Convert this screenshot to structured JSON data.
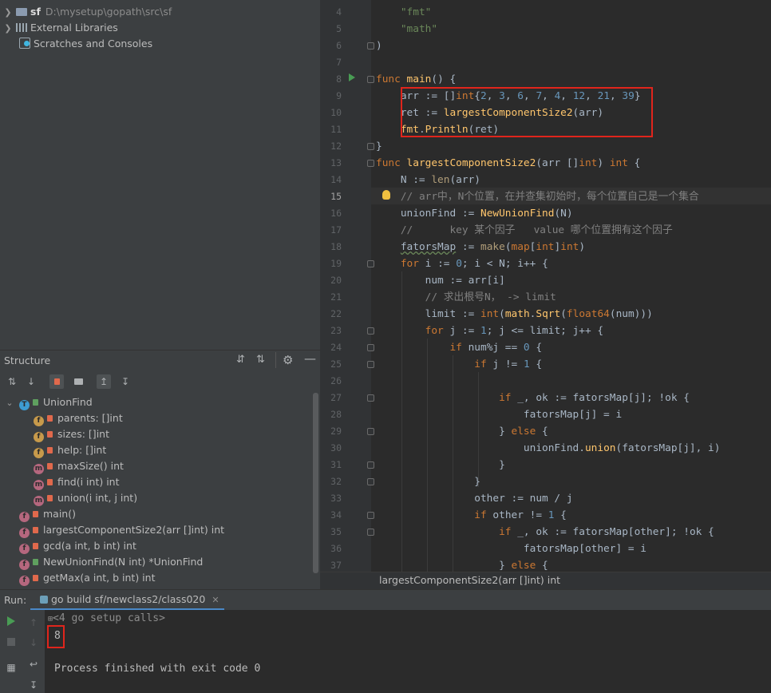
{
  "project_tree": {
    "root_name": "sf",
    "root_path": "D:\\mysetup\\gopath\\src\\sf",
    "external_libraries": "External Libraries",
    "scratches": "Scratches and Consoles"
  },
  "structure": {
    "title": "Structure",
    "items": [
      {
        "label": "UnionFind"
      },
      {
        "label": "parents: []int"
      },
      {
        "label": "sizes: []int"
      },
      {
        "label": "help: []int"
      },
      {
        "label": "maxSize() int"
      },
      {
        "label": "find(i int) int"
      },
      {
        "label": "union(i int, j int)"
      },
      {
        "label": "main()"
      },
      {
        "label": "largestComponentSize2(arr []int) int"
      },
      {
        "label": "gcd(a int, b int) int"
      },
      {
        "label": "NewUnionFind(N int) *UnionFind"
      },
      {
        "label": "getMax(a int, b int) int"
      }
    ]
  },
  "editor": {
    "line_numbers": [
      "4",
      "5",
      "6",
      "7",
      "8",
      "9",
      "10",
      "11",
      "12",
      "13",
      "14",
      "15",
      "16",
      "17",
      "18",
      "19",
      "20",
      "21",
      "22",
      "23",
      "24",
      "25",
      "26",
      "27",
      "28",
      "29",
      "30",
      "31",
      "32",
      "33",
      "34",
      "35",
      "36",
      "37"
    ],
    "current_line": "15"
  },
  "breadcrumb": "largestComponentSize2(arr []int) int",
  "run": {
    "label": "Run:",
    "tab_title": "go build sf/newclass2/class020",
    "setup_calls": "<4 go setup calls>",
    "output": "8",
    "exit_message": "Process finished with exit code 0"
  },
  "colors": {
    "highlight_box": "#e0251c",
    "keyword": "#cc7832",
    "function": "#ffc66d",
    "string": "#6a8759",
    "number": "#6897bb"
  }
}
